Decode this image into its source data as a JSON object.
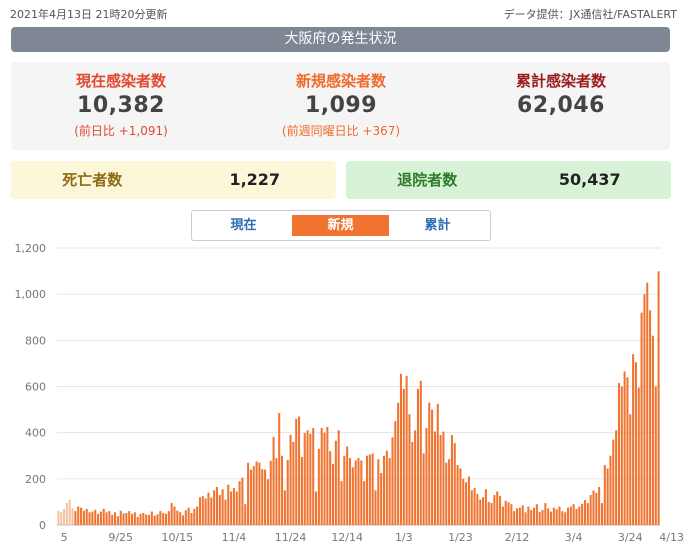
{
  "header": {
    "updated": "2021年4月13日 21時20分更新",
    "source": "データ提供：JX通信社/FASTALERT",
    "title": "大阪府の発生状況"
  },
  "stats": {
    "current": {
      "label": "現在感染者数",
      "value": "10,382",
      "sub": "(前日比 +1,091)"
    },
    "new": {
      "label": "新規感染者数",
      "value": "1,099",
      "sub": "(前週同曜日比 +367)"
    },
    "total": {
      "label": "累計感染者数",
      "value": "62,046"
    }
  },
  "deaths": {
    "label": "死亡者数",
    "value": "1,227"
  },
  "recovered": {
    "label": "退院者数",
    "value": "50,437"
  },
  "tabs": [
    {
      "label": "現在",
      "active": false
    },
    {
      "label": "新規",
      "active": true
    },
    {
      "label": "累計",
      "active": false
    }
  ],
  "colors": {
    "bar": "#f07330",
    "bar_early": "#f6c1a3",
    "title_bg": "#7f8794"
  },
  "chart_data": {
    "type": "bar",
    "title": "",
    "xlabel": "",
    "ylabel": "",
    "ylim": [
      0,
      1200
    ],
    "yticks": [
      0,
      200,
      400,
      600,
      800,
      1000,
      1200
    ],
    "ytick_labels": [
      "0",
      "200",
      "400",
      "600",
      "800",
      "1,000",
      "1,200"
    ],
    "grid": true,
    "x_tick_labels": [
      {
        "date": "2020-09-05",
        "label": "5"
      },
      {
        "date": "2020-09-25",
        "label": "9/25"
      },
      {
        "date": "2020-10-15",
        "label": "10/15"
      },
      {
        "date": "2020-11-04",
        "label": "11/4"
      },
      {
        "date": "2020-11-24",
        "label": "11/24"
      },
      {
        "date": "2020-12-14",
        "label": "12/14"
      },
      {
        "date": "2021-01-03",
        "label": "1/3"
      },
      {
        "date": "2021-01-23",
        "label": "1/23"
      },
      {
        "date": "2021-02-12",
        "label": "2/12"
      },
      {
        "date": "2021-03-04",
        "label": "3/4"
      },
      {
        "date": "2021-03-24",
        "label": "3/24"
      },
      {
        "date": "2021-04-13",
        "label": "4/13"
      }
    ],
    "series": [
      {
        "start_date": "2020-09-03",
        "values": [
          62,
          55,
          70,
          95,
          110,
          72,
          60,
          80,
          75,
          62,
          70,
          55,
          58,
          66,
          48,
          58,
          70,
          55,
          60,
          44,
          55,
          38,
          62,
          50,
          52,
          60,
          48,
          55,
          35,
          48,
          52,
          45,
          44,
          58,
          40,
          46,
          60,
          52,
          48,
          60,
          95,
          80,
          62,
          55,
          42,
          64,
          75,
          52,
          70,
          80,
          120,
          125,
          115,
          140,
          118,
          150,
          165,
          130,
          155,
          110,
          175,
          145,
          160,
          145,
          190,
          205,
          90,
          270,
          240,
          255,
          275,
          270,
          242,
          240,
          198,
          278,
          382,
          290,
          485,
          300,
          150,
          282,
          390,
          360,
          460,
          470,
          295,
          398,
          410,
          395,
          420,
          145,
          330,
          420,
          400,
          425,
          320,
          265,
          365,
          410,
          190,
          300,
          340,
          290,
          250,
          280,
          290,
          280,
          190,
          300,
          305,
          310,
          150,
          285,
          225,
          300,
          322,
          290,
          380,
          450,
          530,
          655,
          590,
          645,
          480,
          360,
          410,
          590,
          625,
          310,
          420,
          530,
          500,
          405,
          525,
          390,
          405,
          270,
          285,
          390,
          355,
          260,
          245,
          200,
          185,
          210,
          150,
          160,
          135,
          110,
          120,
          155,
          100,
          95,
          130,
          145,
          125,
          80,
          105,
          98,
          90,
          60,
          72,
          75,
          85,
          55,
          80,
          65,
          75,
          90,
          56,
          65,
          95,
          72,
          58,
          75,
          68,
          80,
          60,
          55,
          75,
          80,
          90,
          70,
          80,
          92,
          108,
          95,
          130,
          150,
          140,
          165,
          95,
          260,
          245,
          300,
          370,
          410,
          615,
          600,
          665,
          640,
          480,
          740,
          705,
          595,
          920,
          1000,
          1050,
          930,
          820,
          600,
          1099
        ]
      }
    ]
  }
}
